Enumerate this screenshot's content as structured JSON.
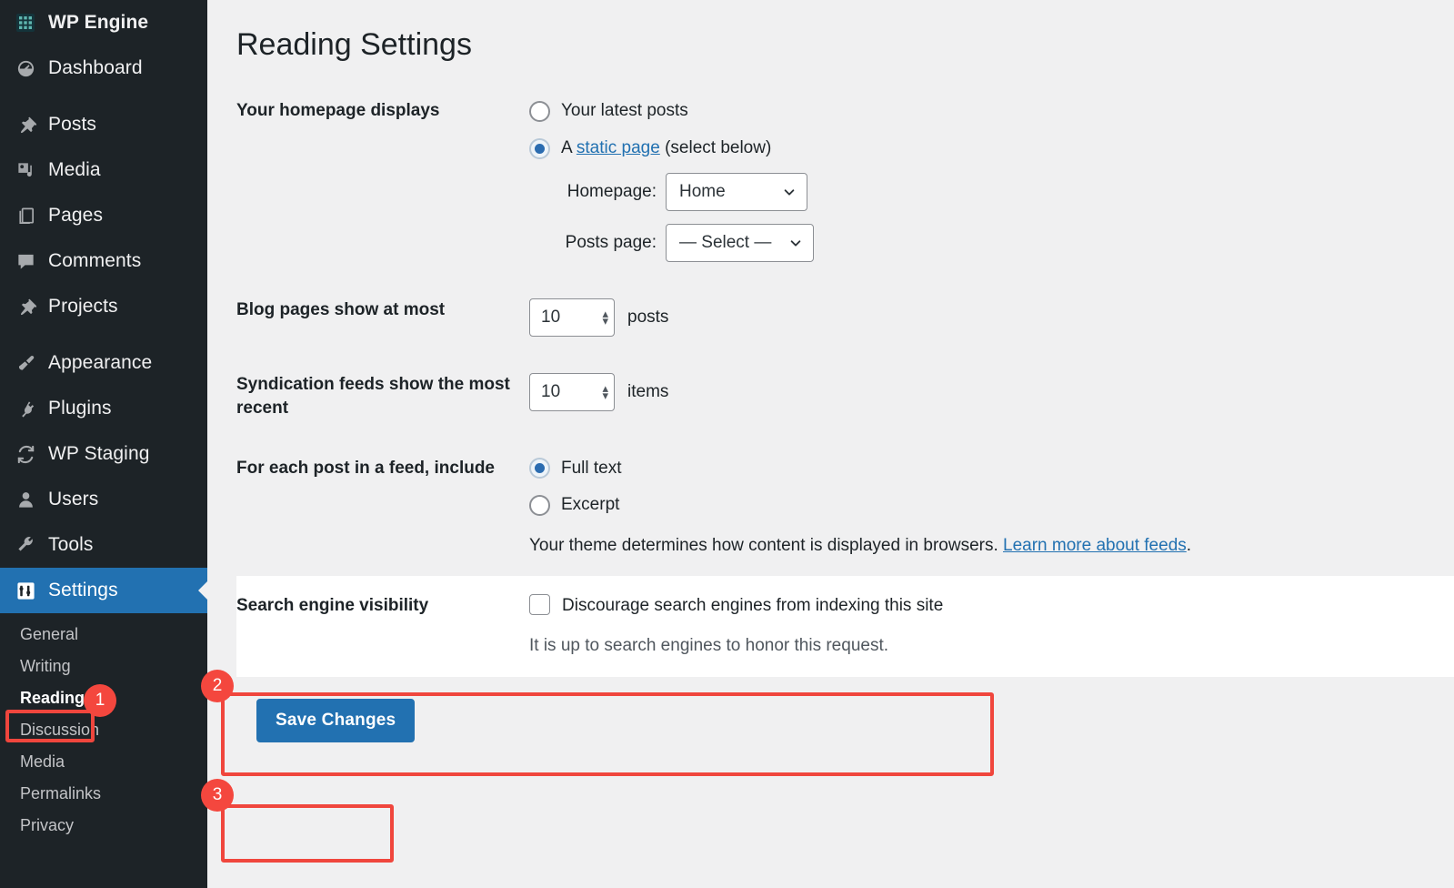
{
  "colors": {
    "sidebar_bg": "#1d2327",
    "accent_blue": "#2271b1",
    "annotation_red": "#f0463d",
    "badge_red": "#f4473e",
    "page_bg": "#f0f0f1",
    "link_blue": "#2271b1"
  },
  "sidebar": {
    "brand": {
      "label": "WP Engine",
      "icon": "wp-engine-grid-icon"
    },
    "items": [
      {
        "label": "Dashboard",
        "icon": "dashboard-icon",
        "current": false
      },
      {
        "label": "Posts",
        "icon": "pin-icon",
        "current": false
      },
      {
        "label": "Media",
        "icon": "media-icon",
        "current": false
      },
      {
        "label": "Pages",
        "icon": "pages-icon",
        "current": false
      },
      {
        "label": "Comments",
        "icon": "comment-icon",
        "current": false
      },
      {
        "label": "Projects",
        "icon": "pin-icon",
        "current": false
      },
      {
        "label": "Appearance",
        "icon": "paintbrush-icon",
        "current": false
      },
      {
        "label": "Plugins",
        "icon": "plug-icon",
        "current": false
      },
      {
        "label": "WP Staging",
        "icon": "refresh-icon",
        "current": false
      },
      {
        "label": "Users",
        "icon": "user-icon",
        "current": false
      },
      {
        "label": "Tools",
        "icon": "wrench-icon",
        "current": false
      },
      {
        "label": "Settings",
        "icon": "settings-icon",
        "current": true
      }
    ],
    "submenu": [
      {
        "label": "General",
        "current": false
      },
      {
        "label": "Writing",
        "current": false
      },
      {
        "label": "Reading",
        "current": true
      },
      {
        "label": "Discussion",
        "current": false
      },
      {
        "label": "Media",
        "current": false
      },
      {
        "label": "Permalinks",
        "current": false
      },
      {
        "label": "Privacy",
        "current": false
      }
    ]
  },
  "main": {
    "page_title": "Reading Settings",
    "homepage_display": {
      "label": "Your homepage displays",
      "option_latest": {
        "text": "Your latest posts",
        "selected": false
      },
      "option_static": {
        "prefix": "A ",
        "link_text": "static page",
        "suffix": " (select below)",
        "selected": true
      },
      "homepage_select": {
        "label": "Homepage:",
        "value": "Home"
      },
      "posts_page_select": {
        "label": "Posts page:",
        "value": "— Select —"
      }
    },
    "blog_pages": {
      "label": "Blog pages show at most",
      "value": "10",
      "unit": "posts"
    },
    "syndication_feeds": {
      "label": "Syndication feeds show the most recent",
      "value": "10",
      "unit": "items"
    },
    "feed_include": {
      "label": "For each post in a feed, include",
      "option_full": {
        "text": "Full text",
        "selected": true
      },
      "option_excerpt": {
        "text": "Excerpt",
        "selected": false
      },
      "note_prefix": "Your theme determines how content is displayed in browsers. ",
      "note_link": "Learn more about feeds",
      "note_suffix": "."
    },
    "search_visibility": {
      "label": "Search engine visibility",
      "checkbox_label": "Discourage search engines from indexing this site",
      "checked": false,
      "description": "It is up to search engines to honor this request."
    },
    "save_label": "Save Changes"
  },
  "annotations": {
    "badge_1": "1",
    "badge_2": "2",
    "badge_3": "3"
  }
}
